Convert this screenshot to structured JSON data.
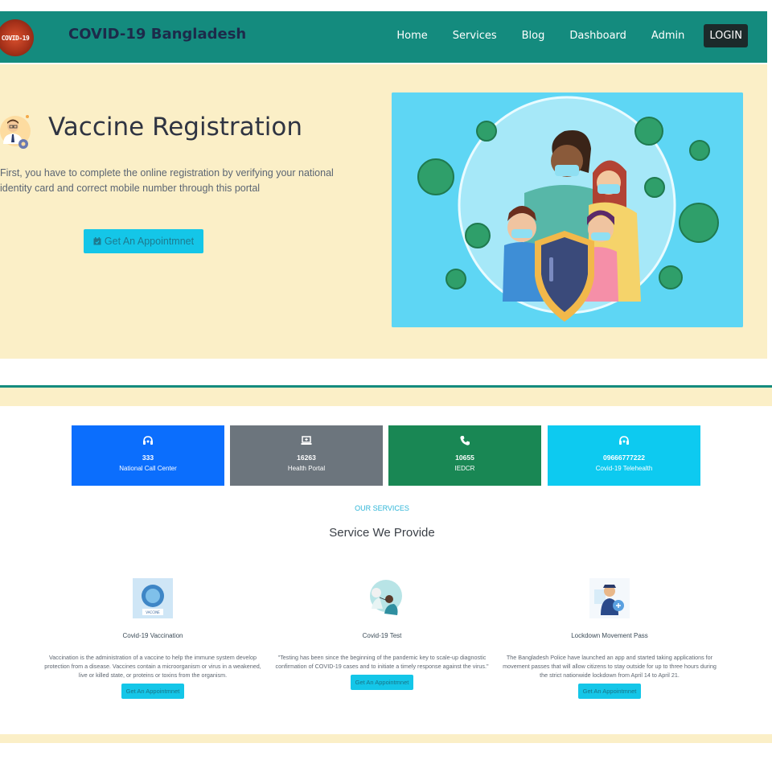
{
  "top": {
    "logo_text": "COVID-19",
    "brand": "COVID-19 Bangladesh",
    "nav": [
      "Home",
      "Services",
      "Blog",
      "Dashboard",
      "Admin"
    ],
    "login": "LOGIN",
    "hero": {
      "title": "Vaccine Registration",
      "text": "First, you have to complete the online registration by verifying your national identity card and correct mobile number through this portal",
      "button": "Get An Appointmnet"
    }
  },
  "bottom": {
    "cards": [
      {
        "number": "333",
        "label": "National Call Center",
        "icon": "headset-icon",
        "color": "#0b6efd"
      },
      {
        "number": "16263",
        "label": "Health Portal",
        "icon": "laptop-medical-icon",
        "color": "#6c757d"
      },
      {
        "number": "10655",
        "label": "IEDCR",
        "icon": "phone-icon",
        "color": "#198754"
      },
      {
        "number": "09666777222",
        "label": "Covid-19 Telehealth",
        "icon": "headset-icon",
        "color": "#0dcaf0"
      }
    ],
    "eyebrow": "OUR SERVICES",
    "section_title": "Service We Provide",
    "services": [
      {
        "title": "Covid-19 Vaccination",
        "image_text": "VACCINE",
        "desc": "Vaccination is the administration of a vaccine to help the immune system develop protection from a disease. Vaccines contain a microorganism or virus in a weakened, live or killed state, or proteins or toxins from the organism.",
        "button": "Get An Appointmnet"
      },
      {
        "title": "Covid-19 Test",
        "desc": "\"Testing has been since the beginning of the pandemic key to scale-up diagnostic confirmation of COVID-19 cases and to initiate a timely response against the virus.\"",
        "button": "Get An Appointmnet"
      },
      {
        "title": "Lockdown Movement Pass",
        "desc": "The Bangladesh Police have launched an app and started taking applications for movement passes that will allow citizens to stay outside for up to three hours during the strict nationwide lockdown from April 14 to April 21.",
        "button": "Get An Appointmnet"
      }
    ]
  },
  "colors": {
    "navbar": "#148b7e",
    "hero_bg": "#fbefc7",
    "accent_cyan": "#14c6e8"
  }
}
